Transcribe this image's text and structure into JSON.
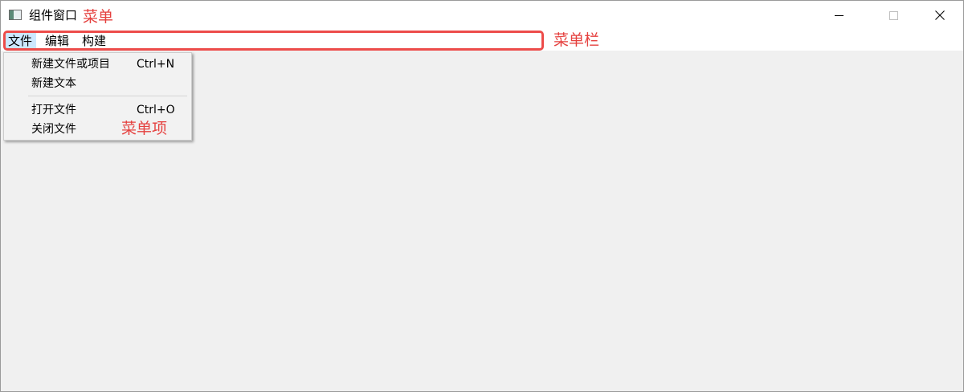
{
  "window": {
    "title": "组件窗口"
  },
  "annotations": {
    "menu": "菜单",
    "menubar": "菜单栏",
    "menu_item": "菜单项"
  },
  "menubar": {
    "items": [
      {
        "label": "文件",
        "active": true
      },
      {
        "label": "编辑",
        "active": false
      },
      {
        "label": "构建",
        "active": false
      }
    ]
  },
  "file_menu": {
    "items": [
      {
        "label": "新建文件或项目",
        "shortcut": "Ctrl+N"
      },
      {
        "label": "新建文本",
        "shortcut": ""
      },
      {
        "label": "打开文件",
        "shortcut": "Ctrl+O"
      },
      {
        "label": "关闭文件",
        "shortcut": ""
      }
    ]
  },
  "icons": {
    "app": "app-window-icon",
    "minimize": "minimize-icon",
    "maximize": "maximize-icon",
    "close": "close-icon"
  },
  "colors": {
    "annotation": "#e5413f",
    "active_menu": "#cce8ff",
    "client_background": "#f0f0f0"
  }
}
